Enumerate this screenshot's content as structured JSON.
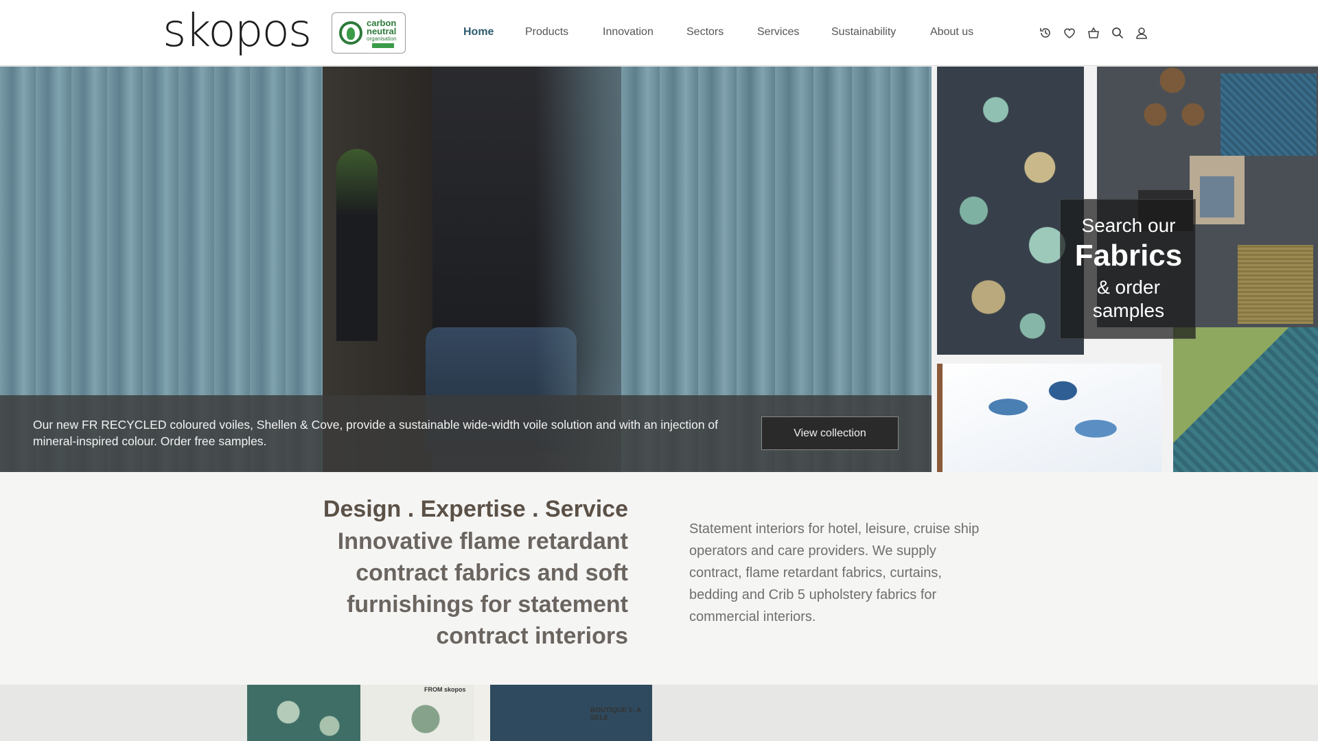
{
  "header": {
    "logo_text": "skopos",
    "badge": {
      "line1": "carbon",
      "line2": "neutral",
      "line3": "organisation"
    },
    "nav": [
      {
        "label": "Home",
        "active": true
      },
      {
        "label": "Products"
      },
      {
        "label": "Innovation"
      },
      {
        "label": "Sectors"
      },
      {
        "label": "Services"
      },
      {
        "label": "Sustainability"
      },
      {
        "label": "About us"
      }
    ],
    "icons": [
      "history-icon",
      "heart-icon",
      "basket-icon",
      "search-icon",
      "user-icon"
    ]
  },
  "hero": {
    "caption": "Our new FR RECYCLED coloured voiles, Shellen & Cove, provide a sustainable wide-width voile solution and with an injection of mineral-inspired colour. Order free samples.",
    "button_label": "View collection"
  },
  "promo": {
    "line1": "Search our",
    "line2": "Fabrics",
    "line3": "& order",
    "line4": "samples"
  },
  "intro": {
    "title": "Design . Expertise . Service",
    "subtitle": "Innovative flame retardant contract fabrics and soft furnishings for statement contract interiors",
    "body": "Statement interiors for hotel, leisure, cruise ship operators and care providers. We supply contract, flame retardant fabrics, curtains, bedding and Crib 5 upholstery fabrics for commercial interiors."
  },
  "bottom": {
    "label1": "FROM skopos",
    "label2": "BOUTIQUE 1: A SELE"
  },
  "colors": {
    "nav_active": "#2c5a6e",
    "heading": "#5b5147",
    "button_bg": "#2a2a2a"
  }
}
